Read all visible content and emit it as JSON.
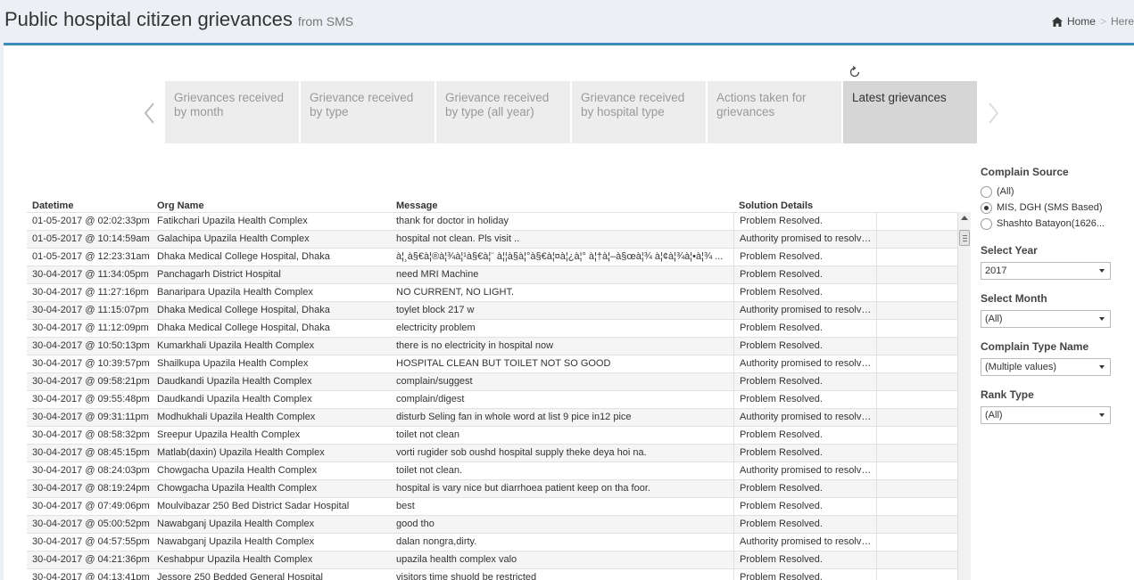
{
  "header": {
    "title": "Public hospital citizen grievances",
    "subtitle": "from SMS",
    "breadcrumb_home": "Home",
    "breadcrumb_separator": ">",
    "breadcrumb_current": "Here"
  },
  "colors": {
    "accent": "#3c8dbc",
    "tab_active": "#d6d6d6",
    "tab_inactive": "#ededed"
  },
  "icons": {
    "refresh": "refresh-icon",
    "home": "home-icon",
    "prev": "chevron-left-icon",
    "next": "chevron-right-icon"
  },
  "tabs": [
    {
      "label": "Grievances received by month",
      "active": false
    },
    {
      "label": "Grievance received by type",
      "active": false
    },
    {
      "label": "Grievance received by type (all year)",
      "active": false
    },
    {
      "label": "Grievance received by hospital type",
      "active": false
    },
    {
      "label": "Actions taken for grievances",
      "active": false
    },
    {
      "label": "Latest grievances",
      "active": true
    }
  ],
  "table": {
    "columns": [
      "Datetime",
      "Org Name",
      "Message",
      "Solution Details"
    ],
    "rows": [
      [
        "01-05-2017 @ 02:02:33pm",
        "Fatikchari Upazila Health Complex",
        "thank for doctor in holiday",
        "Problem Resolved."
      ],
      [
        "01-05-2017 @ 10:14:59am",
        "Galachipa Upazila Health Complex",
        " hospital  not clean. Pls visit ..",
        "Authority promised to resolve ..."
      ],
      [
        "01-05-2017 @ 12:23:31am",
        "Dhaka Medical College Hospital, Dhaka",
        "à¦¸à§€à¦®à¦¾à¦¹à§€à¦¨ à¦¦à§à¦°à§€à¦¤à¦¿à¦° à¦†à¦–à§œà¦¾ à¦¢à¦¾à¦•à¦¾ ...",
        "Problem Resolved."
      ],
      [
        "30-04-2017 @ 11:34:05pm",
        "Panchagarh District Hospital",
        "need MRI Machine",
        "Problem Resolved."
      ],
      [
        "30-04-2017 @ 11:27:16pm",
        "Banaripara Upazila Health Complex",
        "NO CURRENT, NO LIGHT.",
        "Problem Resolved."
      ],
      [
        "30-04-2017 @ 11:15:07pm",
        "Dhaka Medical College Hospital, Dhaka",
        "toylet block 217 w",
        "Authority promised to resolve ..."
      ],
      [
        "30-04-2017 @ 11:12:09pm",
        "Dhaka Medical College Hospital, Dhaka",
        "electricity problem",
        "Problem Resolved."
      ],
      [
        "30-04-2017 @ 10:50:13pm",
        "Kumarkhali Upazila Health Complex",
        "there is no electricity in hospital now",
        "Problem Resolved."
      ],
      [
        "30-04-2017 @ 10:39:57pm",
        "Shailkupa Upazila Health Complex",
        "HOSPITAL CLEAN BUT TOILET NOT SO GOOD",
        "Authority promised to resolve ..."
      ],
      [
        "30-04-2017 @ 09:58:21pm",
        "Daudkandi Upazila Health Complex",
        "complain/suggest",
        "Problem Resolved."
      ],
      [
        "30-04-2017 @ 09:55:48pm",
        "Daudkandi Upazila Health Complex",
        "complain/digest",
        "Problem Resolved."
      ],
      [
        "30-04-2017 @ 09:31:11pm",
        "Modhukhali Upazila Health Complex",
        "disturb Seling fan in whole word at list 9 pice in12 pice",
        "Authority promised to resolve ..."
      ],
      [
        "30-04-2017 @ 08:58:32pm",
        "Sreepur Upazila Health Complex",
        " toilet not clean",
        "Problem Resolved."
      ],
      [
        "30-04-2017 @ 08:45:15pm",
        "Matlab(daxin) Upazila Health Complex",
        "vorti rugider sob oushd hospital supply theke deya hoi na.",
        "Problem Resolved."
      ],
      [
        "30-04-2017 @ 08:24:03pm",
        "Chowgacha Upazila Health Complex",
        "toilet not clean.",
        "Authority promised to resolve ..."
      ],
      [
        "30-04-2017 @ 08:19:24pm",
        "Chowgacha Upazila Health Complex",
        "hospital is vary nice but diarrhoea patient keep on tha foor.",
        "Problem Resolved."
      ],
      [
        "30-04-2017 @ 07:49:06pm",
        "Moulvibazar 250 Bed District Sadar Hospital",
        "best",
        "Problem Resolved."
      ],
      [
        "30-04-2017 @ 05:00:52pm",
        "Nawabganj Upazila Health Complex",
        "good tho",
        "Problem Resolved."
      ],
      [
        "30-04-2017 @ 04:57:55pm",
        "Nawabganj Upazila Health Complex",
        "dalan nongra,dirty.",
        "Authority promised to resolve ..."
      ],
      [
        "30-04-2017 @ 04:21:36pm",
        "Keshabpur Upazila Health Complex",
        "upazila health complex valo",
        "Problem Resolved."
      ],
      [
        "30-04-2017 @ 04:13:41pm",
        "Jessore 250 Bedded General Hospital",
        "visitors time shuold be restricted",
        "Problem Resolved."
      ]
    ]
  },
  "filters": {
    "complain_source": {
      "title": "Complain Source",
      "options": [
        {
          "label": "(All)",
          "checked": false
        },
        {
          "label": "MIS, DGH (SMS Based)",
          "checked": true
        },
        {
          "label": "Shashto Batayon(1626...",
          "checked": false
        }
      ]
    },
    "year": {
      "title": "Select Year",
      "value": "2017"
    },
    "month": {
      "title": "Select Month",
      "value": "(All)"
    },
    "complain_type": {
      "title": "Complain Type Name",
      "value": "(Multiple values)"
    },
    "rank_type": {
      "title": "Rank Type",
      "value": "(All)"
    }
  }
}
